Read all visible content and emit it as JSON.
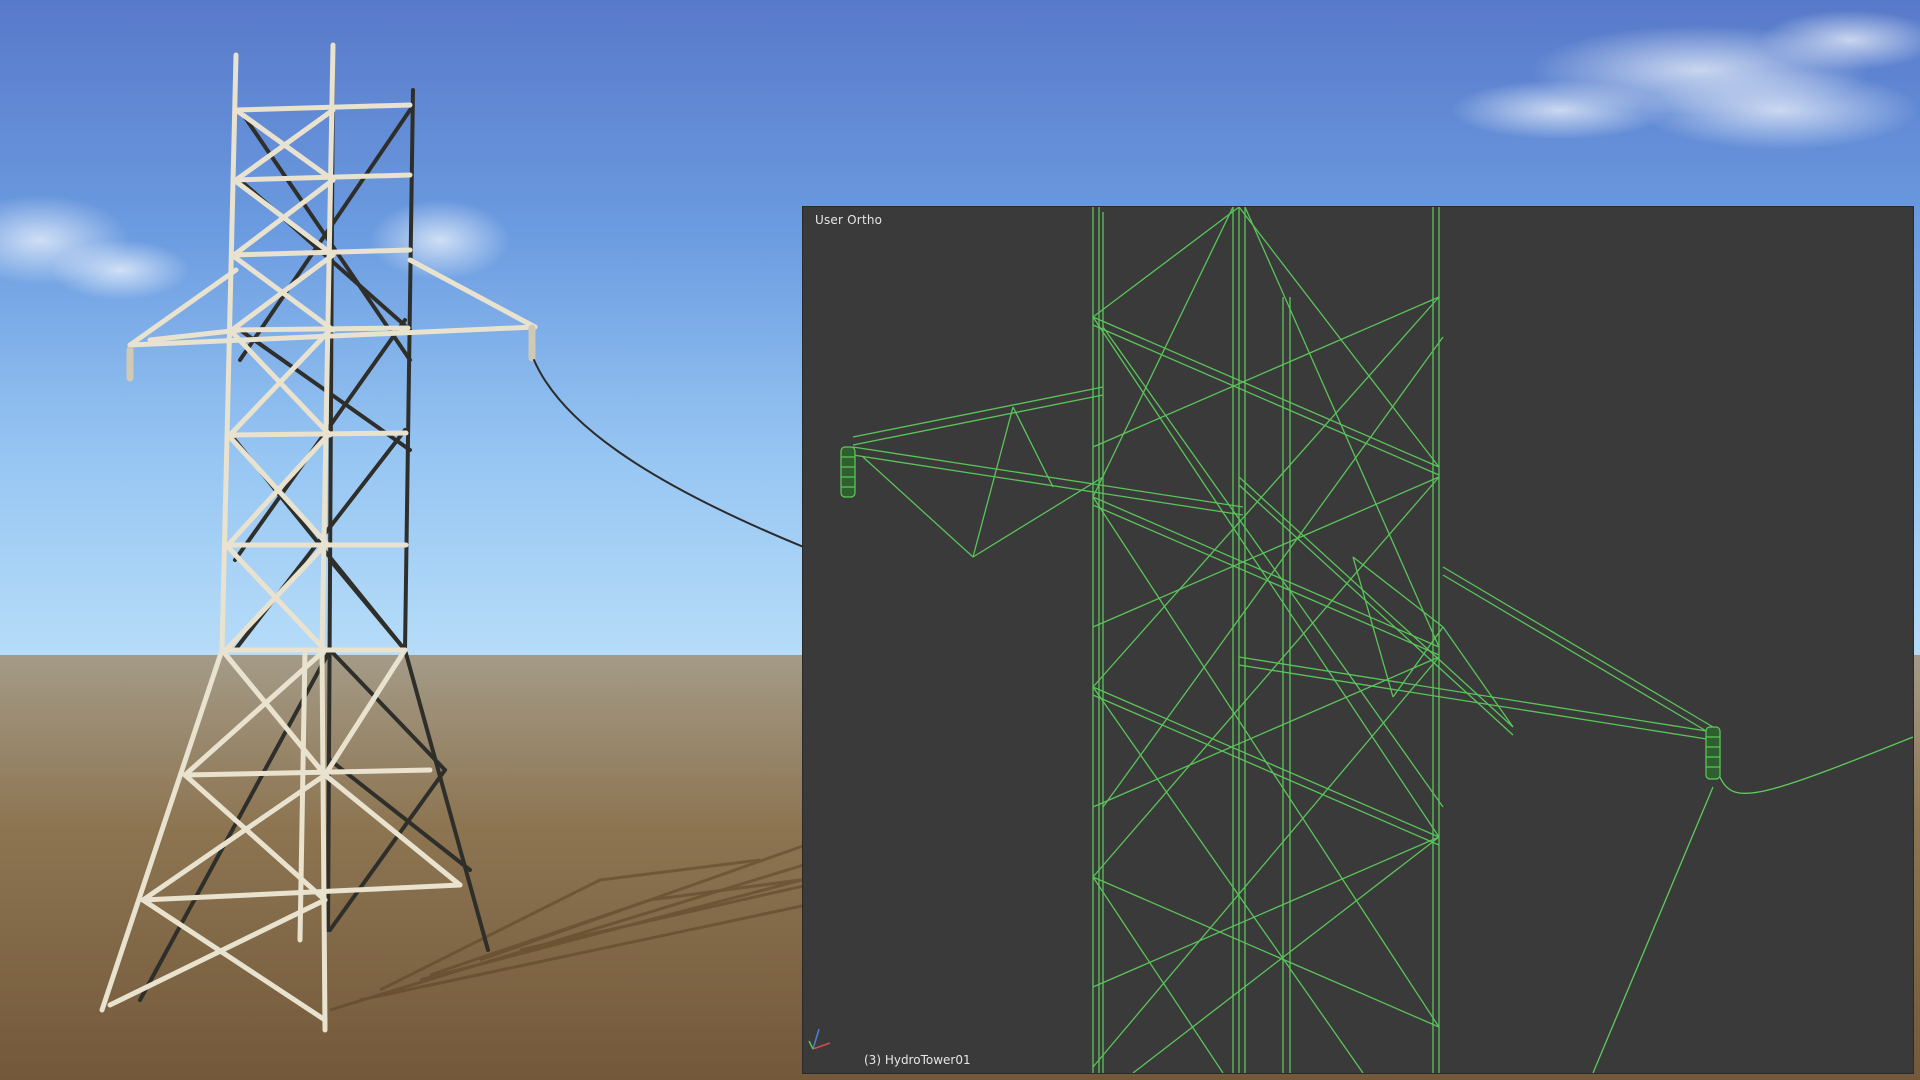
{
  "viewport": {
    "view_label": "User Ortho",
    "object_label": "(3) HydroTower01"
  },
  "icons": {
    "axis_gizmo": "axis-gizmo-icon"
  },
  "colors": {
    "sky_top": "#5b82cf",
    "sky_bottom": "#aad4f5",
    "ground_top": "#a09680",
    "ground_bottom": "#7a5f3a",
    "tower_light": "#e8e2cf",
    "tower_dark": "#2e2e2a",
    "viewport_bg": "#3a3a3a",
    "wireframe": "#56c956",
    "text": "#e6e6e6"
  }
}
